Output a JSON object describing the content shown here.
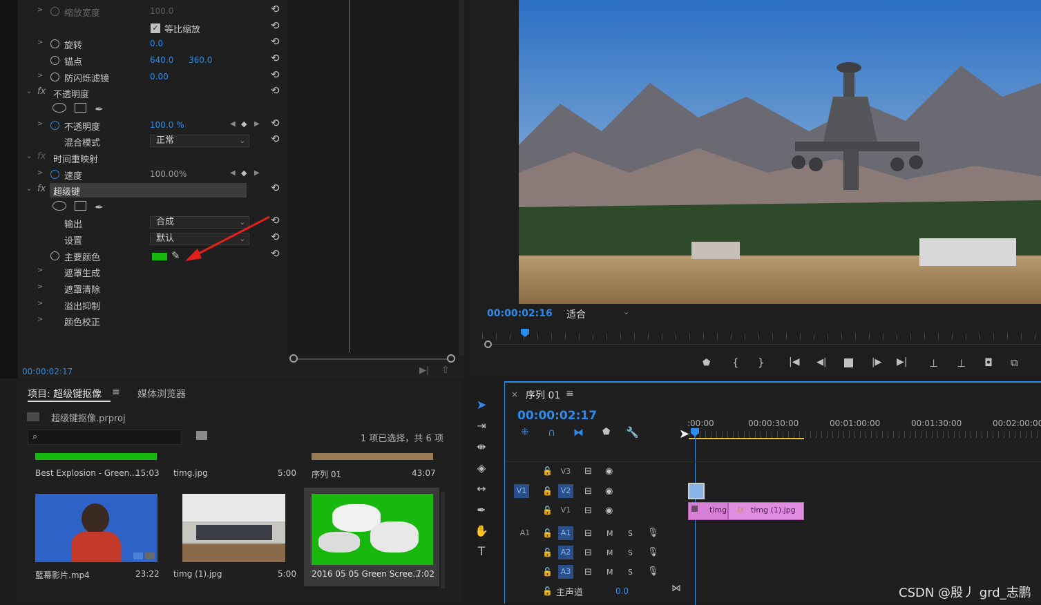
{
  "effect_controls": {
    "rows": [
      {
        "label": "缩放宽度",
        "value": "100.0"
      },
      {
        "label": "等比缩放"
      },
      {
        "label": "旋转",
        "value": "0.0"
      },
      {
        "label": "锚点",
        "value": "640.0",
        "value2": "360.0"
      },
      {
        "label": "防闪烁滤镜",
        "value": "0.00"
      },
      {
        "label": "不透明度"
      },
      {
        "label": "不透明度",
        "value": "100.0 %"
      },
      {
        "label": "混合模式",
        "value": "正常"
      },
      {
        "label": "时间重映射"
      },
      {
        "label": "速度",
        "value": "100.00%"
      },
      {
        "label": "超级键"
      },
      {
        "label": "输出",
        "value": "合成"
      },
      {
        "label": "设置",
        "value": "默认"
      },
      {
        "label": "主要颜色",
        "color": "#17b80f"
      },
      {
        "label": "遮罩生成"
      },
      {
        "label": "遮罩清除"
      },
      {
        "label": "溢出抑制"
      },
      {
        "label": "颜色校正"
      }
    ],
    "fx_label": "fx",
    "timecode": "00:00:02:17"
  },
  "program_monitor": {
    "timecode": "00:00:02:16",
    "fit_label": "适合"
  },
  "project": {
    "tab_project": "项目: 超级键抠像",
    "tab_media": "媒体浏览器",
    "file": "超级键抠像.prproj",
    "selection_info": "1 项已选择，共 6 项",
    "search_placeholder": "",
    "items": [
      {
        "name": "Best Explosion - Green...",
        "duration": "15:03"
      },
      {
        "name": "timg.jpg",
        "duration": "5:00"
      },
      {
        "name": "序列 01",
        "duration": "43:07"
      },
      {
        "name": "藍幕影片.mp4",
        "duration": "23:22"
      },
      {
        "name": "timg (1).jpg",
        "duration": "5:00"
      },
      {
        "name": "2016 05 05 Green Scree...",
        "duration": "7:02"
      }
    ]
  },
  "sequence": {
    "close": "×",
    "name": "序列 01",
    "timecode": "00:00:02:17",
    "ruler": [
      ":00:00",
      "00:00:30:00",
      "00:01:00:00",
      "00:01:30:00",
      "00:02:00:00"
    ],
    "tracks": {
      "v3": "V3",
      "v2": "V2",
      "v1": "V1",
      "v1_src": "V1",
      "a1_src": "A1",
      "a1": "A1",
      "a2": "A2",
      "a3": "A3",
      "m": "M",
      "s": "S",
      "master": "主声道",
      "master_value": "0.0"
    },
    "clip1": "timg.",
    "clip2": "timg (1).jpg",
    "clip_fx": "fx"
  },
  "watermark": "CSDN @殷丿 grd_志鹏",
  "colors": {
    "accent": "#2d8ceb",
    "clip_pink": "#d880d8",
    "green": "#17b80f"
  }
}
